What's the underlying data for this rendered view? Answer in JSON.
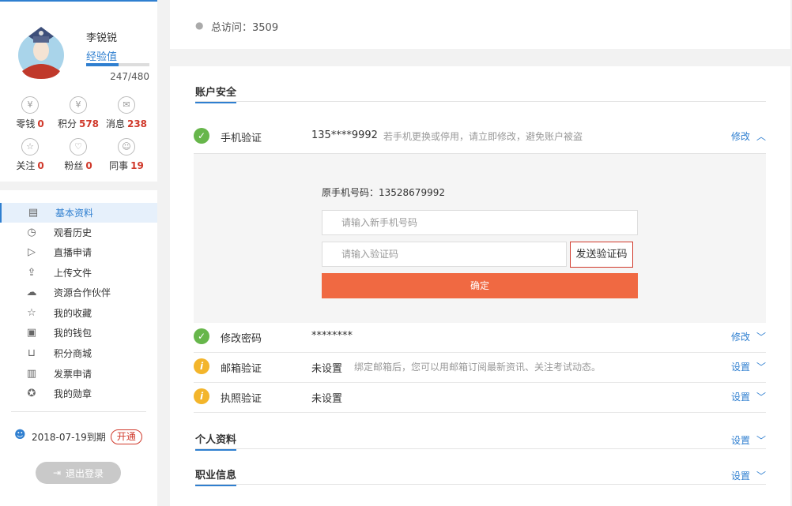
{
  "user": {
    "name": "李锐锐",
    "exp_label": "经验值",
    "exp_value": "247/480",
    "exp_fraction": 0.51
  },
  "stats": [
    {
      "label": "零钱",
      "value": "0",
      "icon": "wallet-icon"
    },
    {
      "label": "积分",
      "value": "578",
      "icon": "points-icon"
    },
    {
      "label": "消息",
      "value": "238",
      "icon": "mail-icon"
    },
    {
      "label": "关注",
      "value": "0",
      "icon": "star-icon"
    },
    {
      "label": "粉丝",
      "value": "0",
      "icon": "fans-icon"
    },
    {
      "label": "同事",
      "value": "19",
      "icon": "colleagues-icon"
    }
  ],
  "menu": [
    {
      "label": "基本资料",
      "icon": "profile-icon",
      "active": true
    },
    {
      "label": "观看历史",
      "icon": "history-icon"
    },
    {
      "label": "直播申请",
      "icon": "live-icon"
    },
    {
      "label": "上传文件",
      "icon": "upload-icon"
    },
    {
      "label": "资源合作伙伴",
      "icon": "partner-icon"
    },
    {
      "label": "我的收藏",
      "icon": "favorites-icon"
    },
    {
      "label": "我的钱包",
      "icon": "wallet-icon"
    },
    {
      "label": "积分商城",
      "icon": "shop-icon"
    },
    {
      "label": "发票申请",
      "icon": "invoice-icon"
    },
    {
      "label": "我的勋章",
      "icon": "medal-icon"
    }
  ],
  "vip": {
    "expire_text": "2018-07-19到期",
    "open_label": "开通"
  },
  "logout_label": "退出登录",
  "visits": {
    "text": "总访问：3509"
  },
  "security": {
    "title": "账户安全",
    "phone": {
      "name": "手机验证",
      "value": "135****9992",
      "desc": "若手机更换或停用，请立即修改，避免账户被盗",
      "action": "修改",
      "status": "ok"
    },
    "phone_panel": {
      "original": "原手机号码：13528679992",
      "new_phone_placeholder": "请输入新手机号码",
      "code_placeholder": "请输入验证码",
      "send_code": "发送验证码",
      "confirm": "确定"
    },
    "password": {
      "name": "修改密码",
      "value": "********",
      "action": "修改",
      "status": "ok"
    },
    "email": {
      "name": "邮箱验证",
      "value": "未设置",
      "desc": "绑定邮箱后，您可以用邮箱订阅最新资讯、关注考试动态。",
      "action": "设置",
      "status": "info"
    },
    "license": {
      "name": "执照验证",
      "value": "未设置",
      "action": "设置",
      "status": "info"
    }
  },
  "personal": {
    "title": "个人资料",
    "action": "设置"
  },
  "career": {
    "title": "职业信息",
    "action": "设置"
  },
  "colors": {
    "accent": "#2f7fd0",
    "danger": "#d0392b",
    "confirm": "#f06942",
    "ok": "#67b64b",
    "warn": "#f3b52b"
  }
}
